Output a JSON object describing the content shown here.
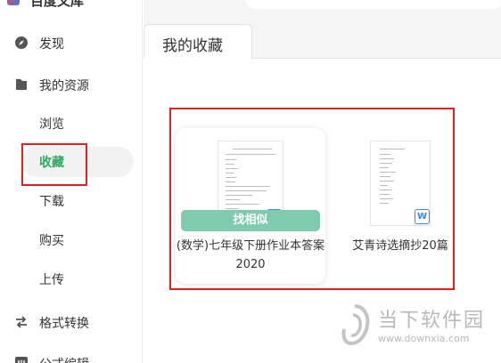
{
  "app": {
    "title": "百度文库"
  },
  "sidebar": {
    "items": [
      {
        "label": "发现",
        "icon": "compass-icon"
      },
      {
        "label": "我的资源",
        "icon": "folder-icon"
      },
      {
        "label": "浏览"
      },
      {
        "label": "收藏"
      },
      {
        "label": "下载"
      },
      {
        "label": "购买"
      },
      {
        "label": "上传"
      },
      {
        "label": "格式转换",
        "icon": "swap-icon"
      },
      {
        "label": "公式编辑",
        "icon": "formula-icon"
      }
    ],
    "active_item": "收藏",
    "accent_color": "#27ae60"
  },
  "tabs": [
    {
      "label": "我的收藏"
    }
  ],
  "documents": [
    {
      "title": "(数学)七年级下册作业本答案2020",
      "file_type": "W",
      "action_label": "找相似"
    },
    {
      "title": "艾青诗选摘抄20篇",
      "file_type": "W"
    }
  ],
  "watermark": {
    "name": "当下软件园",
    "url": "www.downxia.com"
  }
}
